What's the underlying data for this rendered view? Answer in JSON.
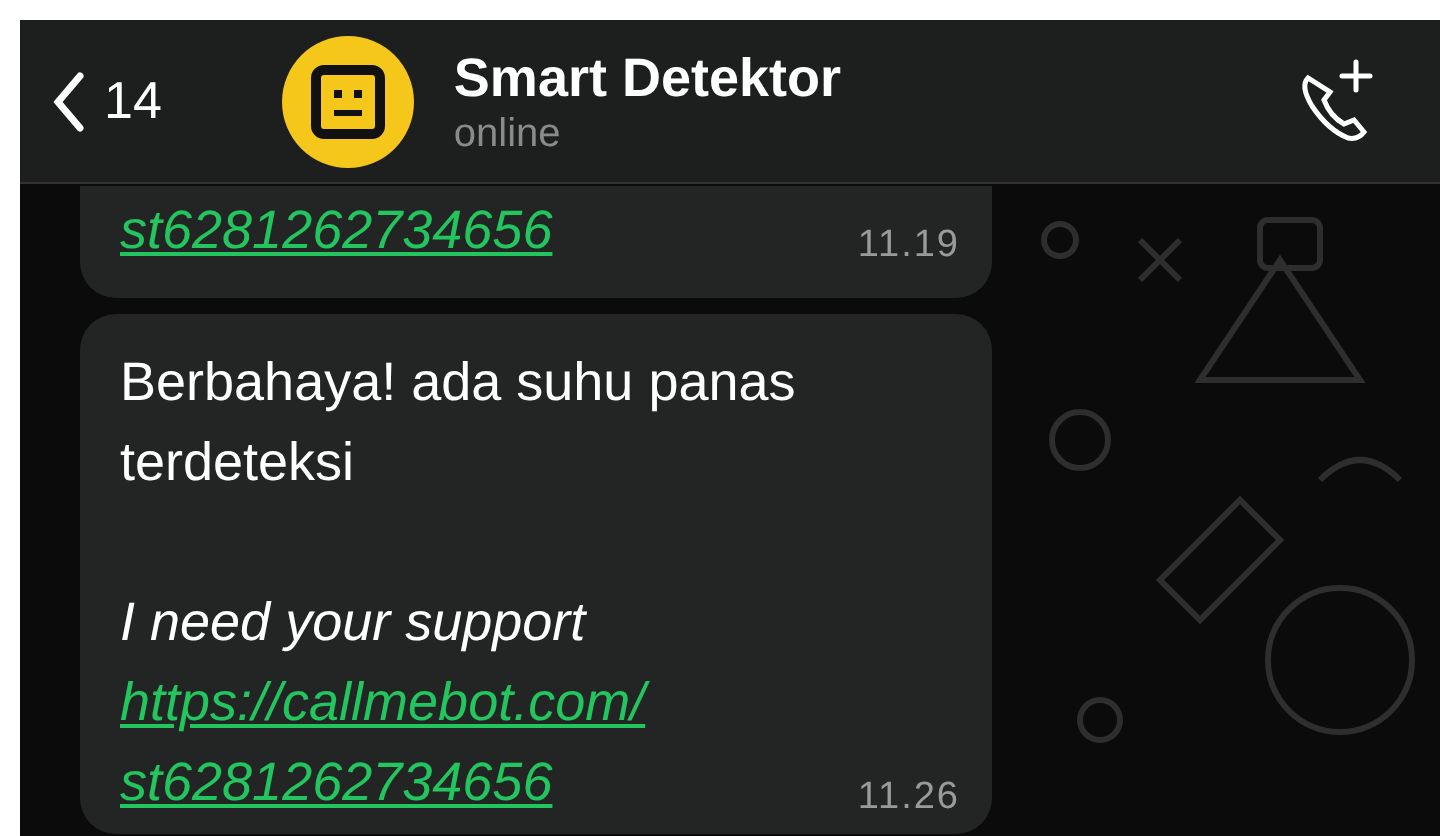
{
  "header": {
    "back_count": "14",
    "contact_name": "Smart Detektor",
    "presence": "online"
  },
  "messages": [
    {
      "link_lines": [
        "st6281262734656"
      ],
      "time": "11.19"
    },
    {
      "paragraphs": [
        {
          "text": "Berbahaya! ada suhu panas terdeteksi",
          "italic": false
        },
        {
          "text": "I need your support",
          "italic": true
        }
      ],
      "link_lines": [
        "https://callmebot.com/",
        "st6281262734656"
      ],
      "time": "11.26"
    }
  ]
}
